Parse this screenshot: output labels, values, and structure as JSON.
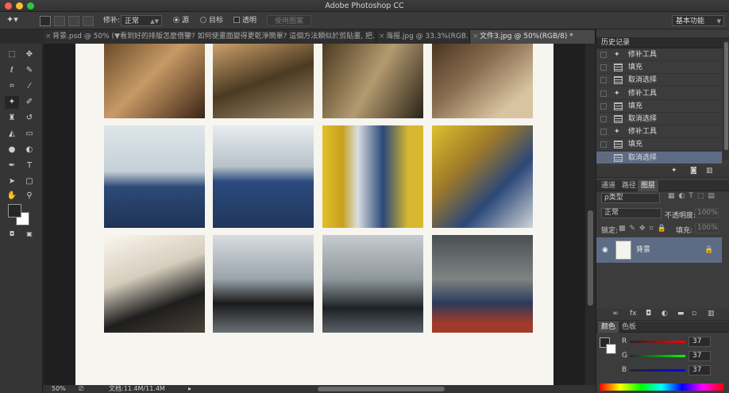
{
  "window": {
    "title": "Adobe Photoshop CC"
  },
  "options_bar": {
    "feather_label": "修补:",
    "mode_value": "正常",
    "radio_source": "源",
    "radio_target": "目标",
    "checkbox_transparent": "透明",
    "use_pattern_button": "使用图案",
    "workspace_select": "基本功能"
  },
  "tabs": [
    {
      "label": "背景.psd @ 50% (▼看到好的排版怎麼借鑒? 如何使畫面變得更乾淨簡單? 這個方法類似於剪貼畫, 把...",
      "active": false
    },
    {
      "label": "海报.jpg @ 33.3%(RGB...",
      "active": false
    },
    {
      "label": "文件3.jpg @ 50%(RGB/8) *",
      "active": true
    }
  ],
  "status_bar": {
    "zoom": "50%",
    "doc_info": "文档:11.4M/11.4M"
  },
  "history_panel": {
    "title": "历史记录",
    "items": [
      {
        "label": "修补工具",
        "icon": "patch-icon"
      },
      {
        "label": "填充",
        "icon": "doc-icon"
      },
      {
        "label": "取消选择",
        "icon": "doc-icon"
      },
      {
        "label": "修补工具",
        "icon": "patch-icon"
      },
      {
        "label": "填充",
        "icon": "doc-icon"
      },
      {
        "label": "取消选择",
        "icon": "doc-icon"
      },
      {
        "label": "修补工具",
        "icon": "patch-icon"
      },
      {
        "label": "填充",
        "icon": "doc-icon"
      },
      {
        "label": "取消选择",
        "icon": "doc-icon",
        "selected": true
      }
    ]
  },
  "layers_panel": {
    "tabs": [
      "通道",
      "路径",
      "图层"
    ],
    "kind_filter": "ρ类型",
    "blend_mode": "正常",
    "opacity_label": "不透明度:",
    "opacity_value": "100%",
    "lock_label": "锁定:",
    "fill_label": "填充:",
    "fill_value": "100%",
    "layer_name": "背景"
  },
  "color_panel": {
    "tabs": [
      "颜色",
      "色板"
    ],
    "r_label": "R",
    "r_value": "37",
    "g_label": "G",
    "g_value": "37",
    "b_label": "B",
    "b_value": "37"
  },
  "colors": {
    "accent_selected": "#5d6b85",
    "foreground_swatch": "#262626",
    "background_swatch": "#ffffff"
  },
  "photos": [
    {
      "row": 1,
      "col": 1,
      "desc": "woman-closeup-warm"
    },
    {
      "row": 1,
      "col": 2,
      "desc": "woman-holding-helmet"
    },
    {
      "row": 1,
      "col": 3,
      "desc": "woman-black-dress"
    },
    {
      "row": 1,
      "col": 4,
      "desc": "woman-sitting-floor"
    },
    {
      "row": 2,
      "col": 1,
      "desc": "woman-denim-railing"
    },
    {
      "row": 2,
      "col": 2,
      "desc": "woman-denim-arm-raised"
    },
    {
      "row": 2,
      "col": 3,
      "desc": "woman-yellow-pole"
    },
    {
      "row": 2,
      "col": 4,
      "desc": "woman-yellow-structure"
    },
    {
      "row": 3,
      "col": 1,
      "desc": "woman-sunlight-black"
    },
    {
      "row": 3,
      "col": 2,
      "desc": "woman-redhair-black"
    },
    {
      "row": 3,
      "col": 3,
      "desc": "woman-silhouette"
    },
    {
      "row": 3,
      "col": 4,
      "desc": "woman-sitting-pipe"
    }
  ]
}
